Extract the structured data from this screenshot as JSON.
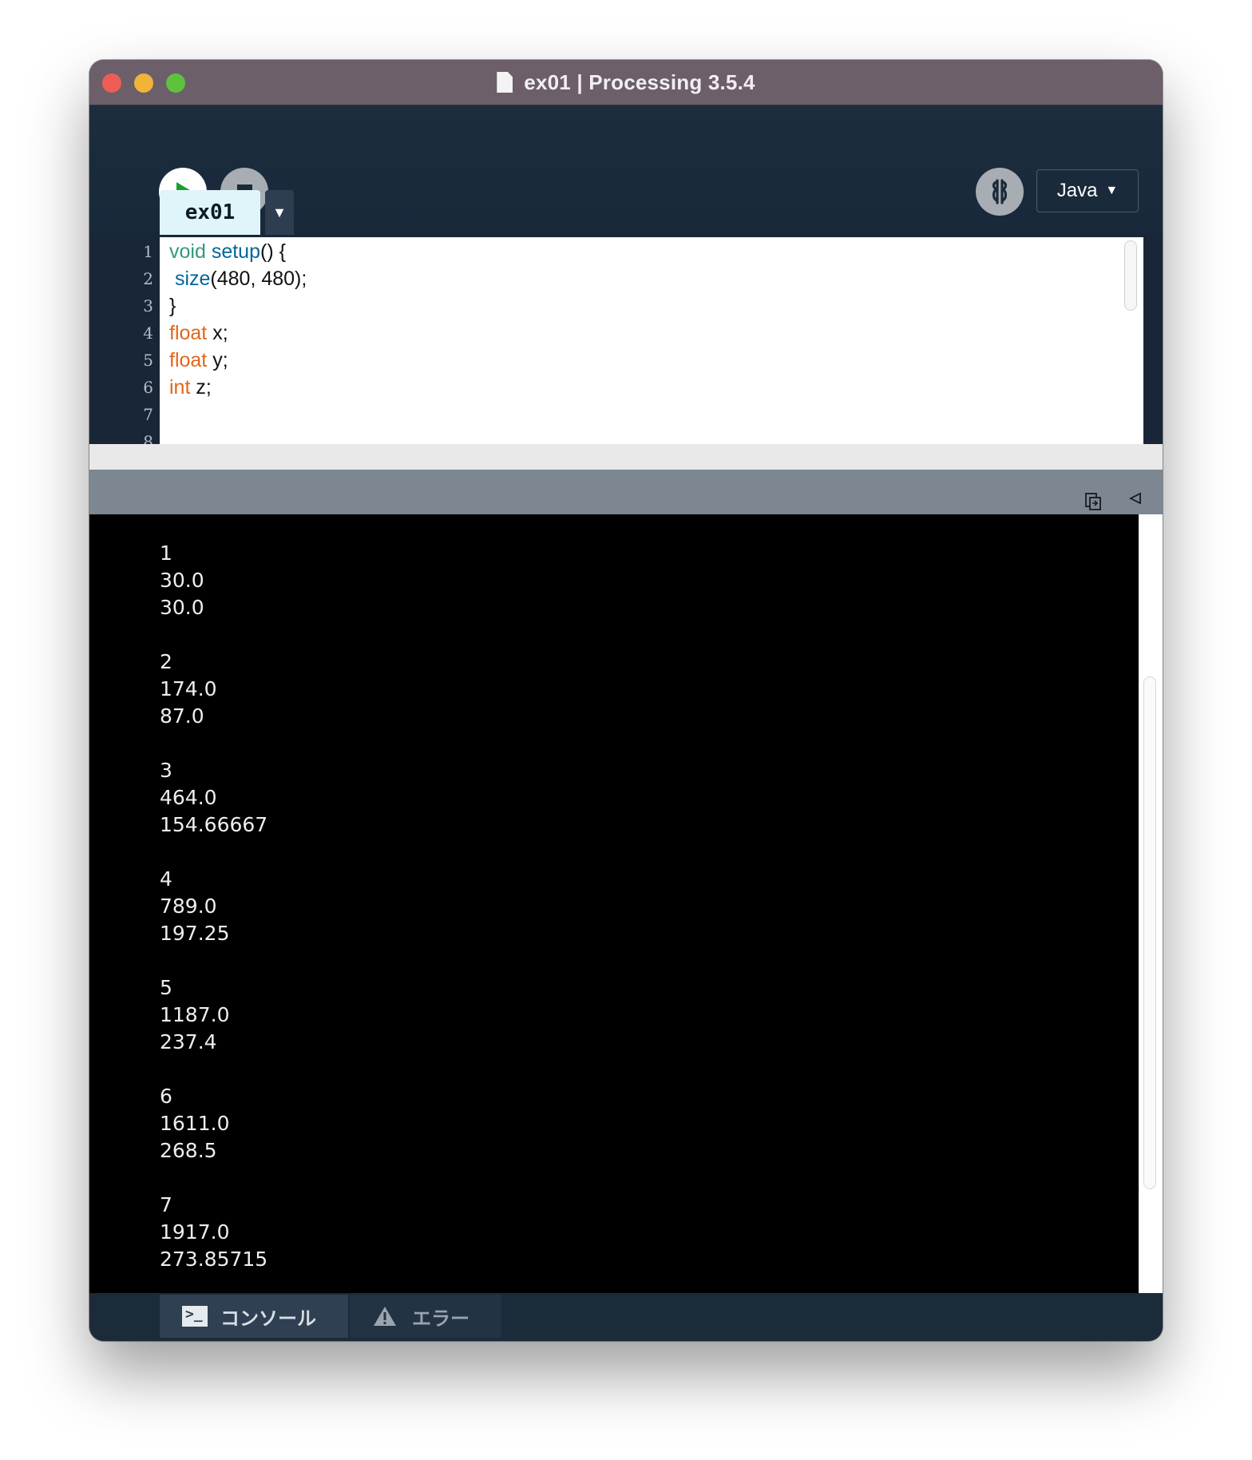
{
  "window": {
    "title": "ex01 | Processing 3.5.4"
  },
  "toolbar": {
    "run_icon": "play-icon",
    "stop_icon": "stop-icon",
    "debug_icon": "debugger-butterfly-icon",
    "mode_label": "Java",
    "mode_caret": "▼"
  },
  "tabs": [
    {
      "label": "ex01",
      "menu_caret": "▼"
    }
  ],
  "editor": {
    "line_numbers": [
      "1",
      "2",
      "3",
      "4",
      "5",
      "6",
      "7",
      "8"
    ],
    "lines": [
      {
        "parts": [
          {
            "t": "void",
            "c": "kw-void"
          },
          {
            "t": " "
          },
          {
            "t": "setup",
            "c": "kw-fn"
          },
          {
            "t": "() {"
          }
        ]
      },
      {
        "parts": [
          {
            "t": " "
          },
          {
            "t": "size",
            "c": "kw-fn"
          },
          {
            "t": "(480, 480);"
          }
        ]
      },
      {
        "parts": [
          {
            "t": "}"
          }
        ]
      },
      {
        "parts": [
          {
            "t": "float",
            "c": "kw-type"
          },
          {
            "t": " x;"
          }
        ]
      },
      {
        "parts": [
          {
            "t": "float",
            "c": "kw-type"
          },
          {
            "t": " y;"
          }
        ]
      },
      {
        "parts": [
          {
            "t": "int",
            "c": "kw-type"
          },
          {
            "t": " z;"
          }
        ]
      },
      {
        "parts": []
      }
    ]
  },
  "console": {
    "lines": [
      "1",
      "30.0",
      "30.0",
      "",
      "2",
      "174.0",
      "87.0",
      "",
      "3",
      "464.0",
      "154.66667",
      "",
      "4",
      "789.0",
      "197.25",
      "",
      "5",
      "1187.0",
      "237.4",
      "",
      "6",
      "1611.0",
      "268.5",
      "",
      "7",
      "1917.0",
      "273.85715"
    ]
  },
  "footer": {
    "console_tab": "コンソール",
    "error_tab": "エラー"
  },
  "colors": {
    "keyword_type": "#e2661a",
    "keyword_function": "#006699",
    "keyword_void": "#33997e",
    "console_bg": "#000000",
    "chrome_bg": "#1b2a3a"
  }
}
